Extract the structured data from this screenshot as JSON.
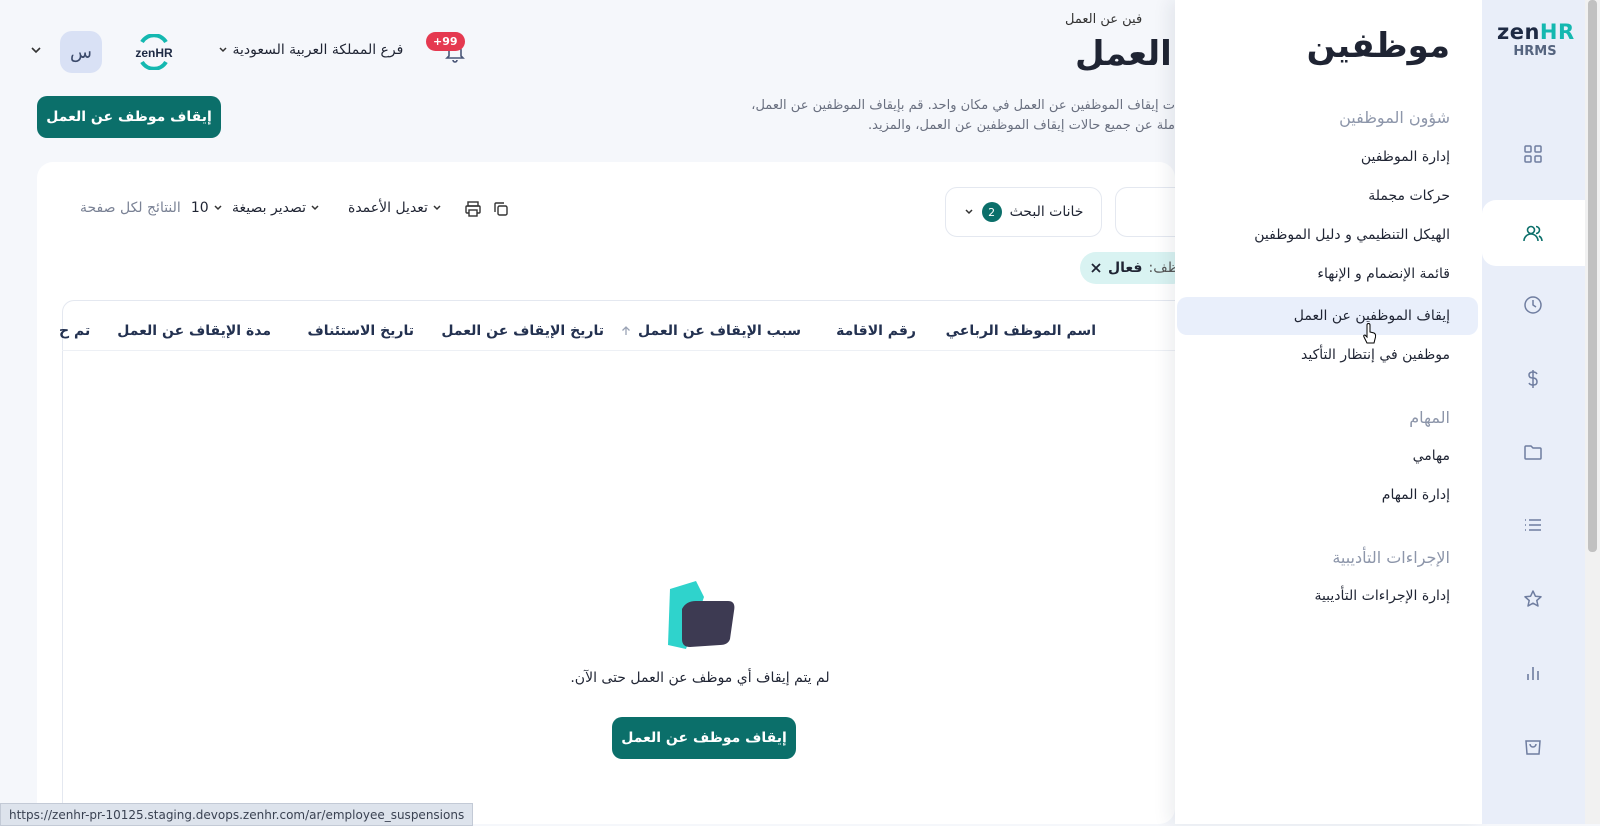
{
  "header": {
    "breadcrumb": "فين عن العمل",
    "page_title": "العمل",
    "description_line1": "ت إيقاف الموظفين عن العمل في مكان واحد. قم بإيقاف الموظفين عن العمل،",
    "description_line2": "ملة عن جميع حالات إيقاف الموظفين عن العمل، والمزيد.",
    "branch": "فرع المملكة العربية السعودية",
    "notifications_badge": "+99",
    "avatar_initial": "س",
    "mini_logo_text": "zenHR"
  },
  "actions": {
    "suspend_button": "إيقاف موظف عن العمل"
  },
  "toolbar": {
    "results_per_page_label": "النتائج لكل صفحة",
    "results_per_page_value": "10",
    "export_label": "تصدير بصيغة",
    "edit_columns_label": "تعديل الأعمدة",
    "search_fields_label": "خانات البحث",
    "search_fields_count": "2"
  },
  "filter_chip": {
    "label": "ظف:",
    "value": "فعال"
  },
  "table": {
    "columns": [
      "اسم الموظف الرباعي",
      "رقم الاقامة",
      "سبب الإيقاف عن العمل",
      "تاريخ الإيقاف عن العمل",
      "تاريخ الاستئناف",
      "مدة الإيقاف عن العمل",
      "تم ح"
    ],
    "rows": []
  },
  "empty_state": {
    "message": "لم يتم إيقاف أي موظف عن العمل حتى الآن.",
    "button": "إيقاف موظف عن العمل"
  },
  "status_bar": {
    "url": "https://zenhr-pr-10125.staging.devops.zenhr.com/ar/employee_suspensions"
  },
  "sidebar": {
    "logo_zen": "zen",
    "logo_hr": "HR",
    "logo_sub": "HRMS",
    "panel_title": "موظفين",
    "sections": [
      {
        "title": "شؤون الموظفين",
        "items": [
          "إدارة الموظفين",
          "حركات مجملة",
          "الهيكل التنظيمي و دليل الموظفين",
          "قائمة الإنضمام و الإنهاء",
          "إيقاف الموظفين عن العمل",
          "موظفين في إنتظار التأكيد"
        ]
      },
      {
        "title": "المهام",
        "items": [
          "مهامي",
          "إدارة المهام"
        ]
      },
      {
        "title": "الإجراءات التأديبية",
        "items": [
          "إدارة الإجراءات التأديبية"
        ]
      }
    ],
    "active_item": "إيقاف الموظفين عن العمل",
    "rail_icons": [
      "grid-icon",
      "users-icon",
      "clock-icon",
      "dollar-icon",
      "folder-icon",
      "list-icon",
      "star-icon",
      "chart-icon",
      "bag-icon"
    ]
  },
  "colors": {
    "primary": "#0b6f6a",
    "accent": "#14b8b0",
    "badge": "#e53950",
    "rail_bg": "#e9eef9",
    "active_item_bg": "#e9effb"
  }
}
